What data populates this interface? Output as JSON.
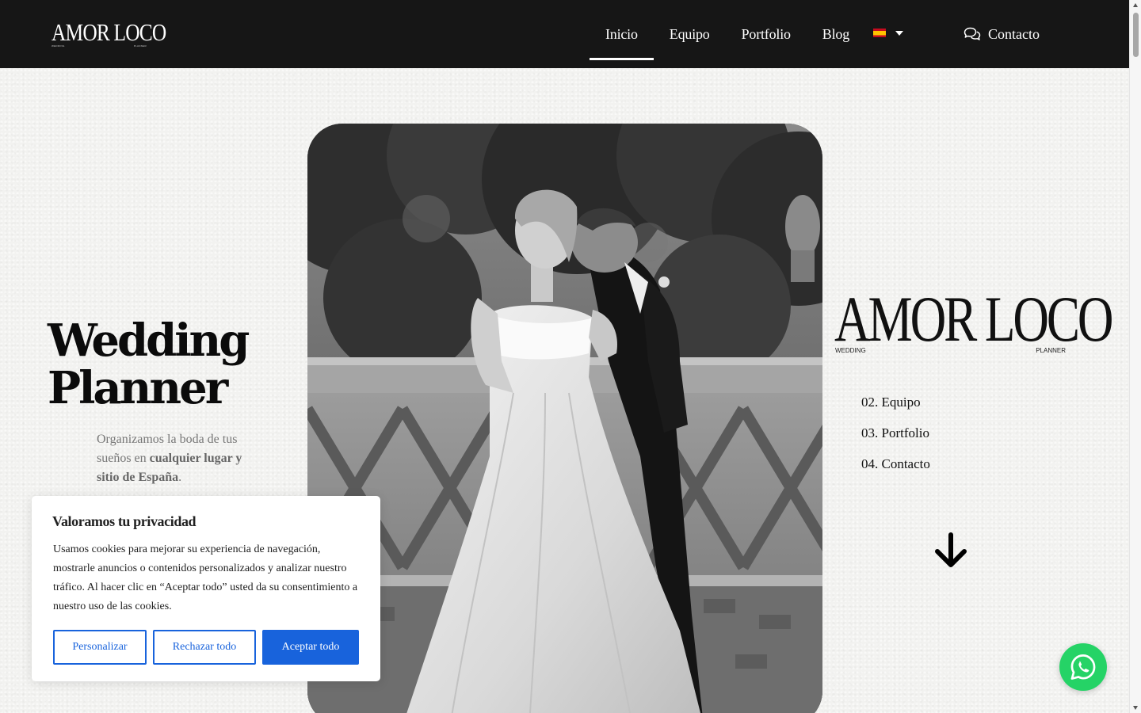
{
  "header": {
    "logo": {
      "text": "AMOR LOCO",
      "sub_left": "WEDDING",
      "sub_right": "PLANNER"
    },
    "nav": [
      {
        "label": "Inicio",
        "active": true
      },
      {
        "label": "Equipo"
      },
      {
        "label": "Portfolio"
      },
      {
        "label": "Blog"
      }
    ],
    "language": {
      "icon": "spain-flag-icon",
      "dropdown_icon": "caret-down-icon"
    },
    "contact": {
      "label": "Contacto",
      "icon": "chat-bubbles-icon"
    }
  },
  "hero": {
    "title_line1": "Wedding",
    "title_line2": "Planner",
    "desc_before": "Organizamos la boda de tus sueños en ",
    "desc_bold": "cualquier lugar y sitio de España",
    "desc_after": "."
  },
  "brand": {
    "text": "AMOR LOCO",
    "sub_left": "WEDDING",
    "sub_right": "PLANNER"
  },
  "side_menu": [
    "02. Equipo",
    "03. Portfolio",
    "04. Contacto"
  ],
  "cookie": {
    "title": "Valoramos tu privacidad",
    "text": "Usamos cookies para mejorar su experiencia de navegación, mostrarle anuncios o contenidos personalizados y analizar nuestro tráfico. Al hacer clic en “Aceptar todo” usted da su consentimiento a nuestro uso de las cookies.",
    "customize": "Personalizar",
    "reject": "Rechazar todo",
    "accept": "Aceptar todo"
  },
  "colors": {
    "header_bg": "#161616",
    "accent_blue": "#1863dc",
    "whatsapp_green": "#25d366"
  }
}
